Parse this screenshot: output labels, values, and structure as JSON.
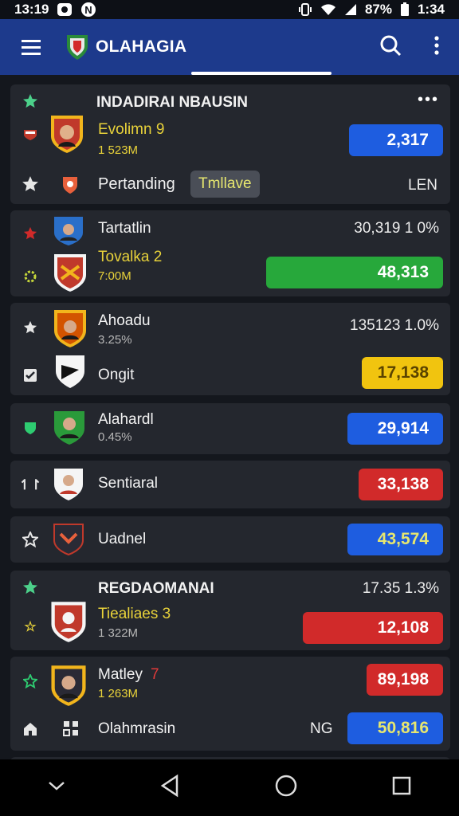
{
  "status": {
    "time": "13:19",
    "battery": "87%",
    "clock_right": "1:34"
  },
  "app": {
    "title": "OLAHAGIA"
  },
  "cards": [
    {
      "header": "INDADIRAI NBAUSIN",
      "player": {
        "name": "Evolimn 9",
        "sub": "1 523M",
        "value": "2,317"
      },
      "bottom": {
        "name": "Pertanding",
        "tag": "Tmllave",
        "right": "LEN"
      }
    },
    {
      "top": {
        "name": "Tartatlin",
        "stat": "30,319 1 0%"
      },
      "player": {
        "name": "Tovalka 2",
        "sub": "7:00M",
        "value": "48,313"
      }
    },
    {
      "top": {
        "name": "Ahoadu",
        "sub": "3.25%",
        "stat": "135123 1.0%"
      },
      "player": {
        "name": "Ongit",
        "value": "17,138"
      }
    },
    {
      "player": {
        "name": "Alahardl",
        "sub": "0.45%",
        "value": "29,914"
      }
    },
    {
      "player": {
        "name": "Sentiaral",
        "value": "33,138"
      }
    },
    {
      "player": {
        "name": "Uadnel",
        "value": "43,574"
      }
    },
    {
      "header": "REGDAOMANAI",
      "stat": "17.35 1.3%",
      "player": {
        "name": "Tiealiaes 3",
        "sub": "1 322M",
        "value": "12,108"
      }
    },
    {
      "top": {
        "name": "Matley",
        "badge": "7",
        "sub": "1 263M",
        "value": "89,198"
      },
      "bottom": {
        "name": "Olahmrasin",
        "short": "NG",
        "value": "50,816"
      }
    }
  ]
}
